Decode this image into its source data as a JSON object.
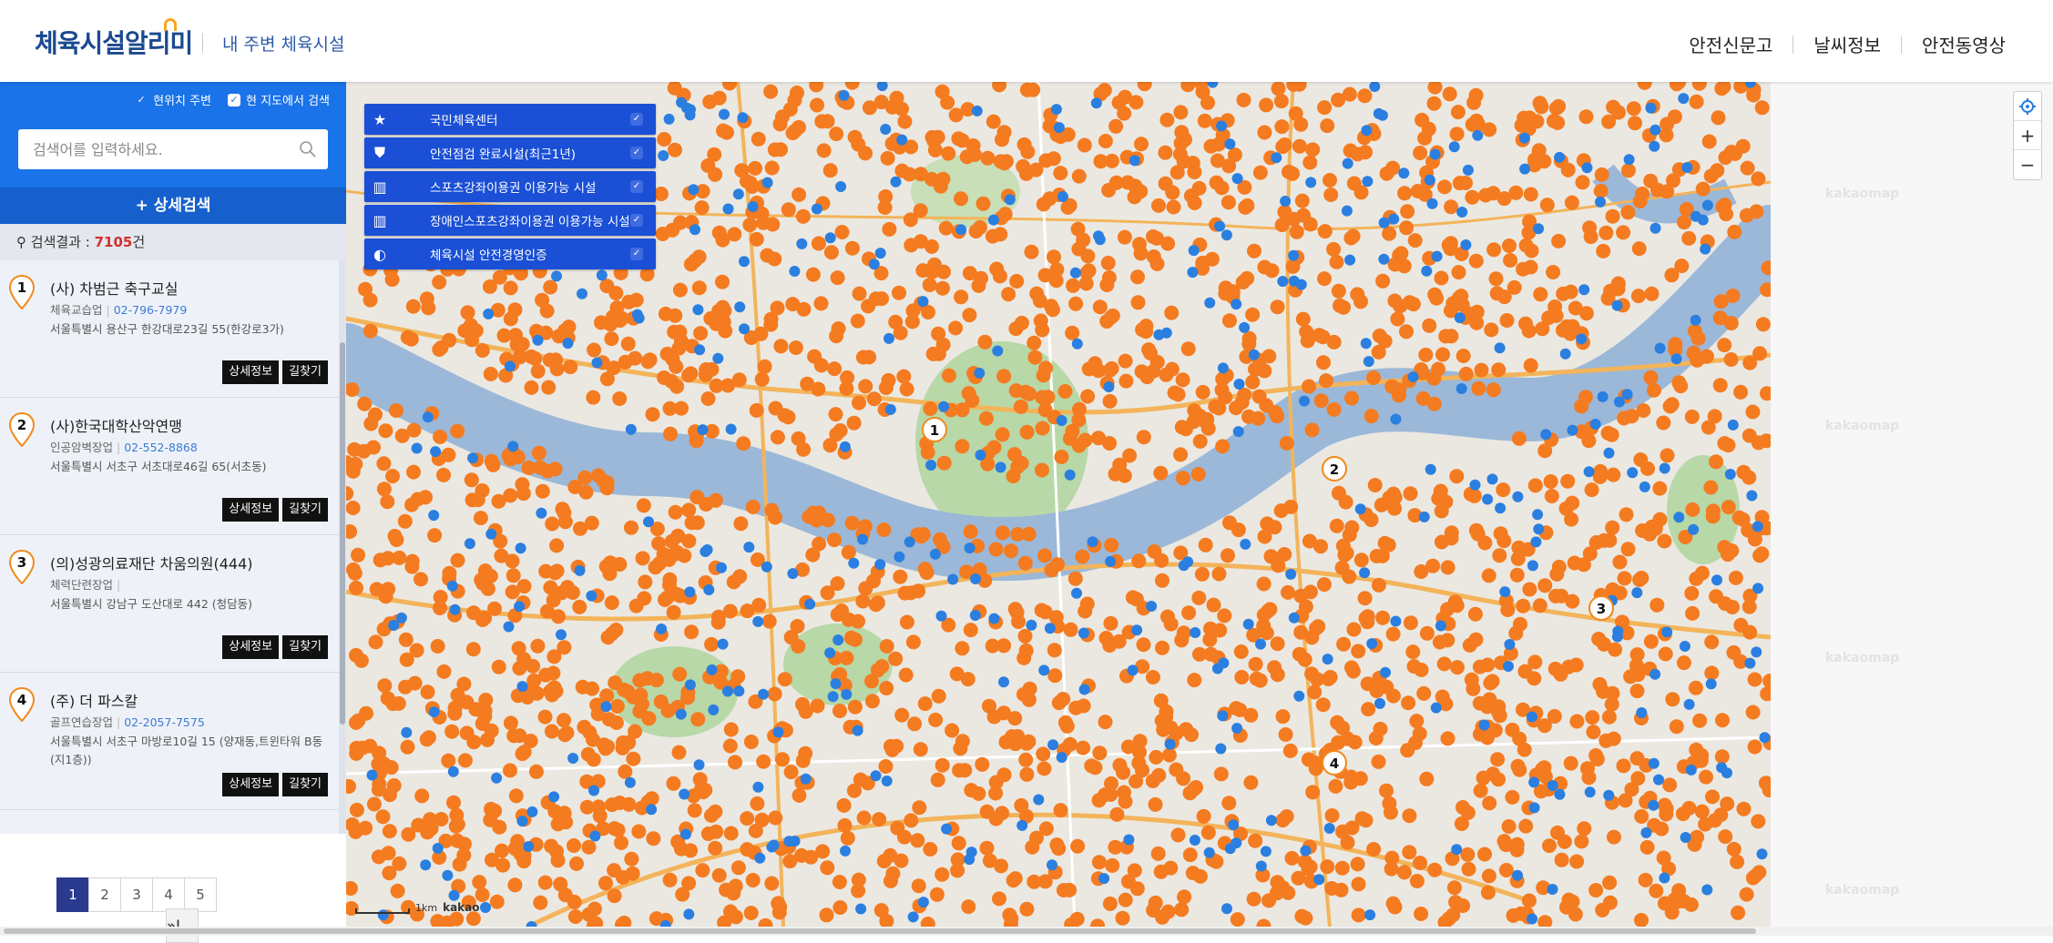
{
  "header": {
    "logo": "체육시설알리미",
    "subtitle": "내 주변 체육시설",
    "nav": [
      "안전신문고",
      "날씨정보",
      "안전동영상"
    ]
  },
  "search": {
    "opt_nearby": "현위치 주변",
    "opt_current_map": "현 지도에서 검색",
    "placeholder": "검색어를 입력하세요.",
    "advanced": "+ 상세검색",
    "result_prefix": "검색결과 : ",
    "result_count": "7105",
    "result_suffix": "건"
  },
  "results": [
    {
      "num": "1",
      "title": "(사) 차범근 축구교실",
      "type": "체육교습업",
      "phone": "02-796-7979",
      "address": "서울특별시 용산구 한강대로23길 55(한강로3가)"
    },
    {
      "num": "2",
      "title": "(사)한국대학산악연맹",
      "type": "인공암벽장업",
      "phone": "02-552-8868",
      "address": "서울특별시 서초구 서초대로46길 65(서초동)"
    },
    {
      "num": "3",
      "title": "(의)성광의료재단 차움의원(444)",
      "type": "체력단련장업",
      "phone": "",
      "address": "서울특별시 강남구 도산대로 442 (청담동)"
    },
    {
      "num": "4",
      "title": "(주) 더 파스칼",
      "type": "골프연습장업",
      "phone": "02-2057-7575",
      "address": "서울특별시 서초구 마방로10길 15 (양재동,트윈타워 B동(지1층))"
    }
  ],
  "buttons": {
    "detail": "상세정보",
    "route": "길찾기"
  },
  "pagination": {
    "pages": [
      "1",
      "2",
      "3",
      "4",
      "5"
    ],
    "next": "›",
    "last": "»|"
  },
  "layers": [
    {
      "label": "국민체육센터",
      "icon": "star-icon"
    },
    {
      "label": "안전점검 완료시설(최근1년)",
      "icon": "shield-check-icon"
    },
    {
      "label": "스포츠강좌이용권 이용가능 시설",
      "icon": "book-icon"
    },
    {
      "label": "장애인스포츠강좌이용권 이용가능 시설",
      "icon": "book-icon"
    },
    {
      "label": "체육시설 안전경영인증",
      "icon": "globe-icon"
    }
  ],
  "map": {
    "scale_label": "1km",
    "provider": "kakao",
    "watermark": "kakaomap",
    "zoom_in": "+",
    "zoom_out": "−",
    "colors": {
      "facility": "#f47b20",
      "public": "#2a7fe0",
      "river": "#9bb8d8",
      "park": "#b8d8a8"
    }
  }
}
